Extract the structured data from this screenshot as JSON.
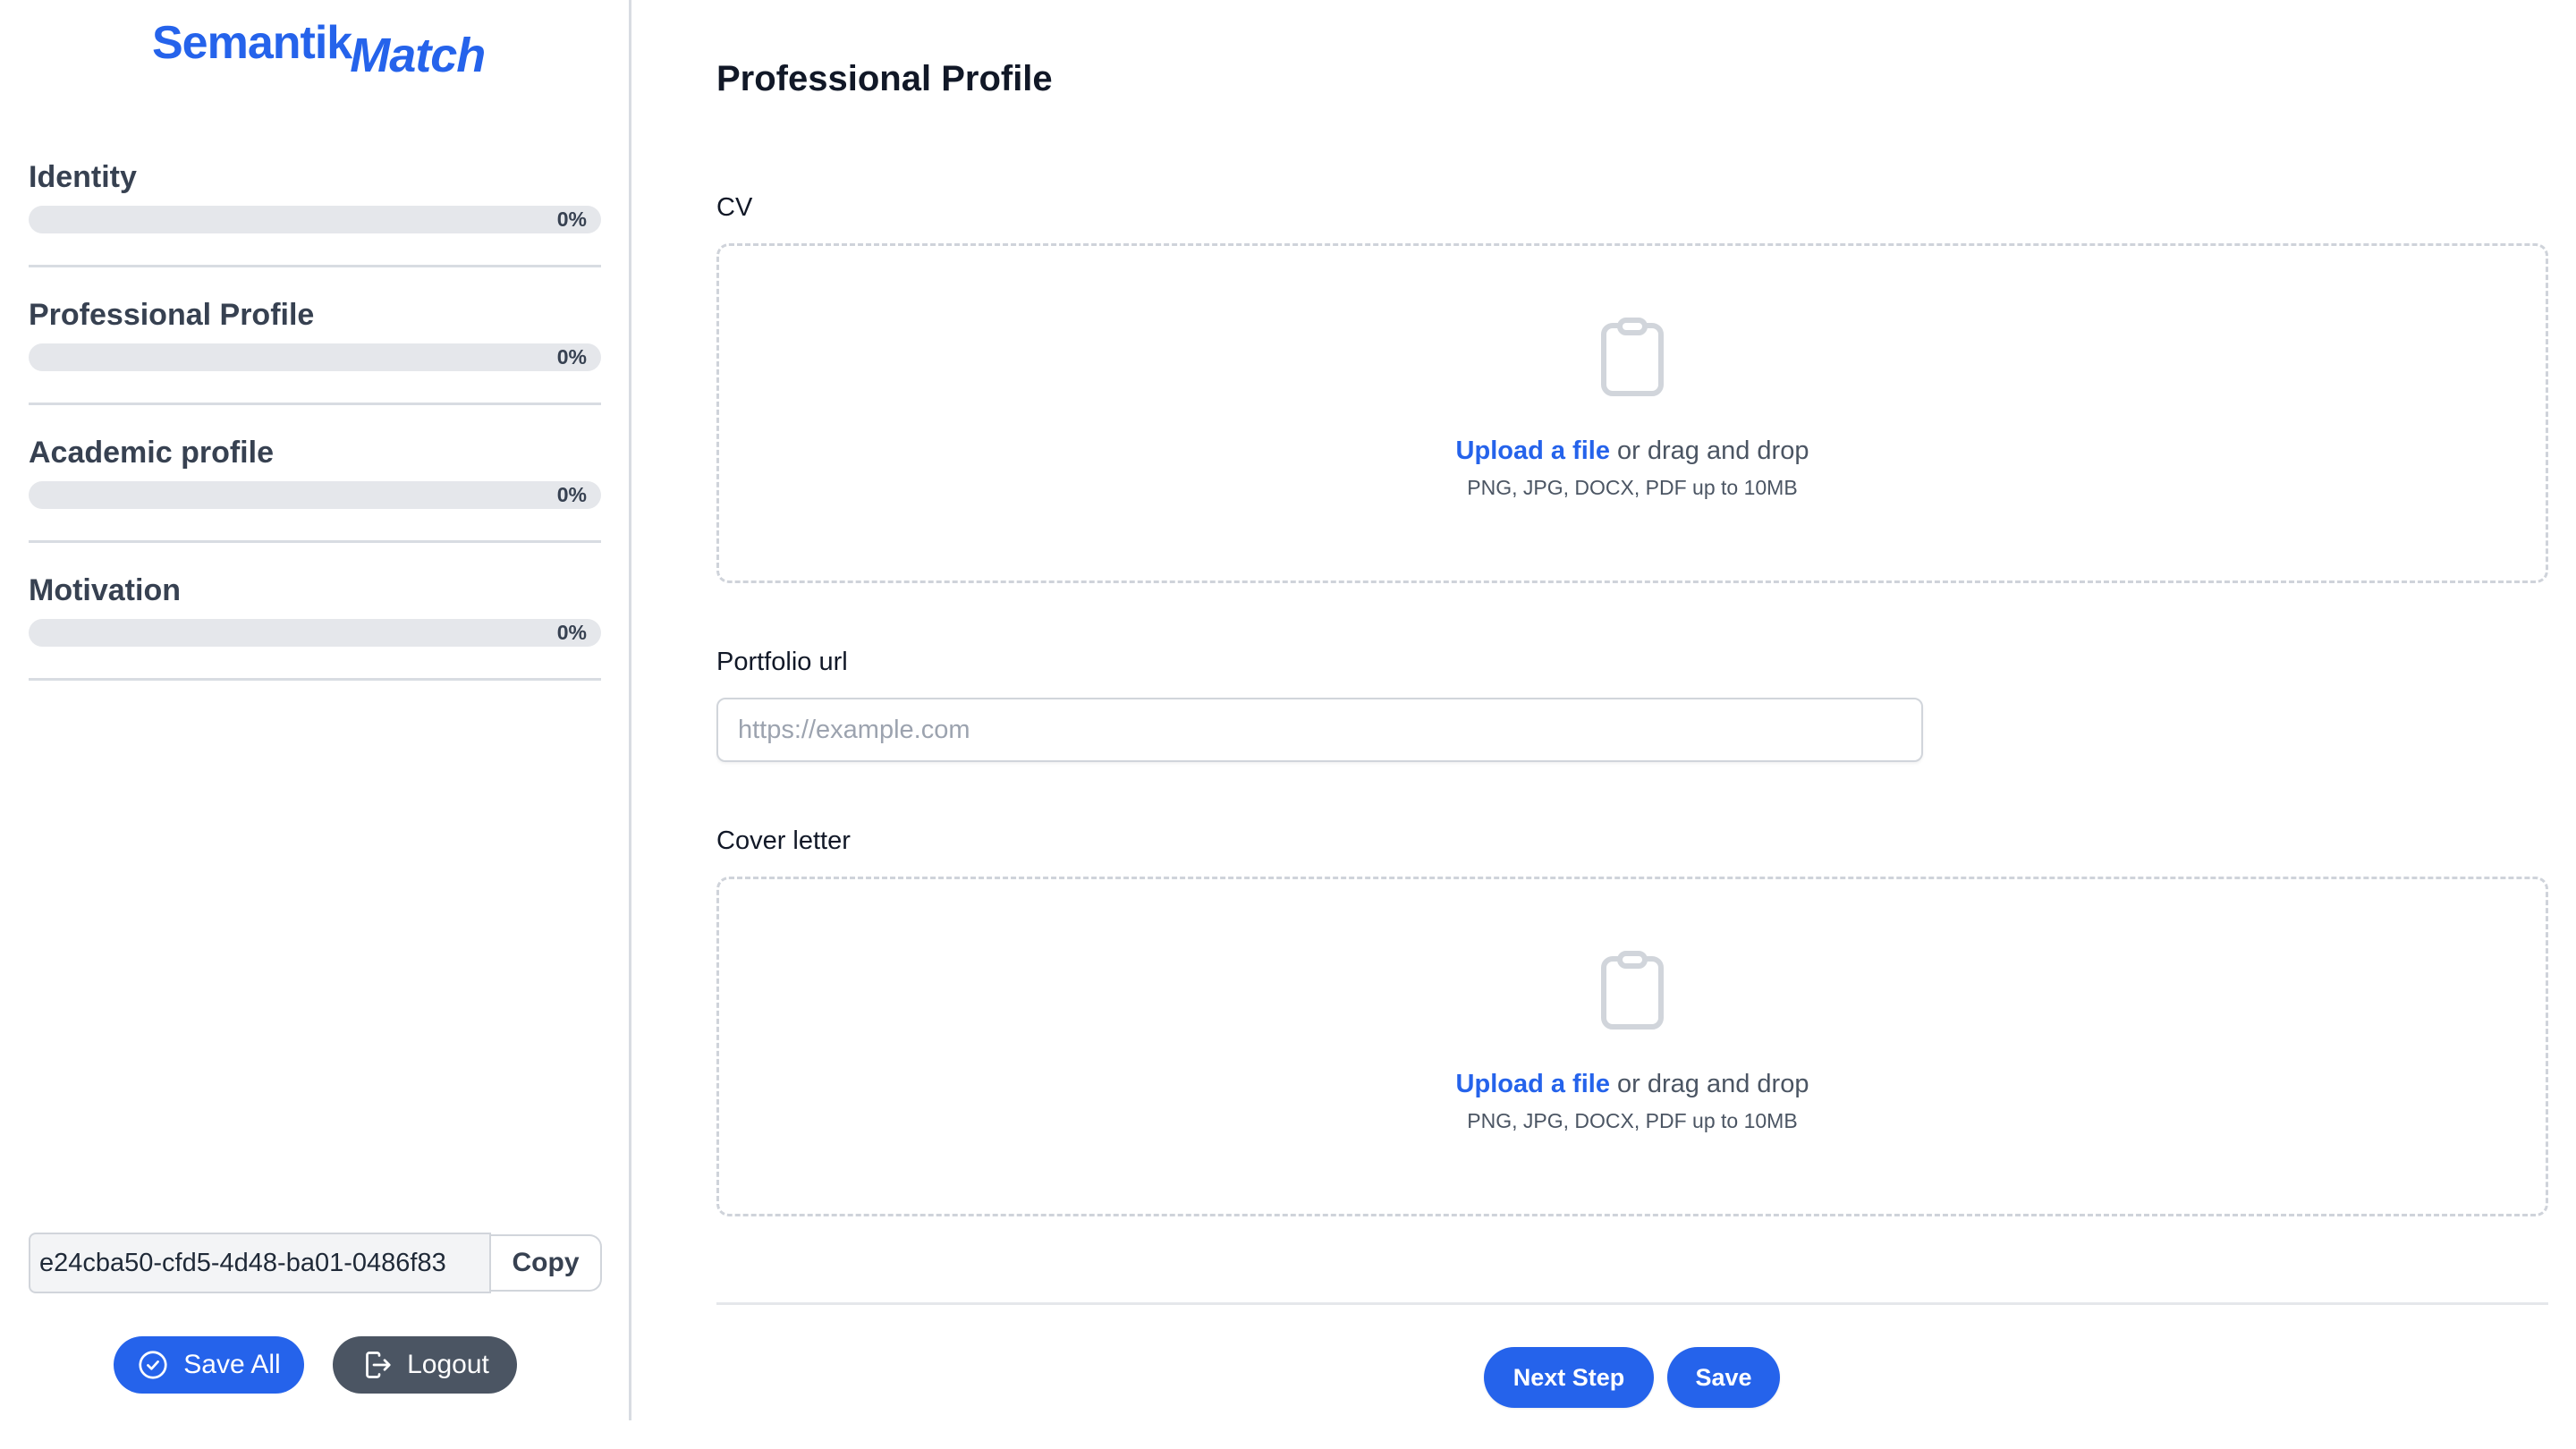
{
  "brand": {
    "part1": "Semantik",
    "part2": "Match",
    "color": "#2563eb"
  },
  "sidebar": {
    "steps": [
      {
        "label": "Identity",
        "progress": 0,
        "progress_text": "0%"
      },
      {
        "label": "Professional Profile",
        "progress": 0,
        "progress_text": "0%"
      },
      {
        "label": "Academic profile",
        "progress": 0,
        "progress_text": "0%"
      },
      {
        "label": "Motivation",
        "progress": 0,
        "progress_text": "0%"
      }
    ],
    "session_id": "e24cba50-cfd5-4d48-ba01-0486f83",
    "copy_label": "Copy",
    "save_all_label": "Save All",
    "logout_label": "Logout"
  },
  "main": {
    "title": "Professional Profile",
    "cv": {
      "label": "CV",
      "upload_link": "Upload a file",
      "upload_rest": " or drag and drop",
      "hint": "PNG, JPG, DOCX, PDF up to 10MB"
    },
    "portfolio": {
      "label": "Portfolio url",
      "value": "",
      "placeholder": "https://example.com"
    },
    "cover_letter": {
      "label": "Cover letter",
      "upload_link": "Upload a file",
      "upload_rest": " or drag and drop",
      "hint": "PNG, JPG, DOCX, PDF up to 10MB"
    },
    "next_step_label": "Next Step",
    "save_label": "Save"
  },
  "colors": {
    "primary": "#2563eb",
    "secondary": "#4b5563",
    "progress_track": "#e5e7eb",
    "border": "#d1d5db"
  }
}
